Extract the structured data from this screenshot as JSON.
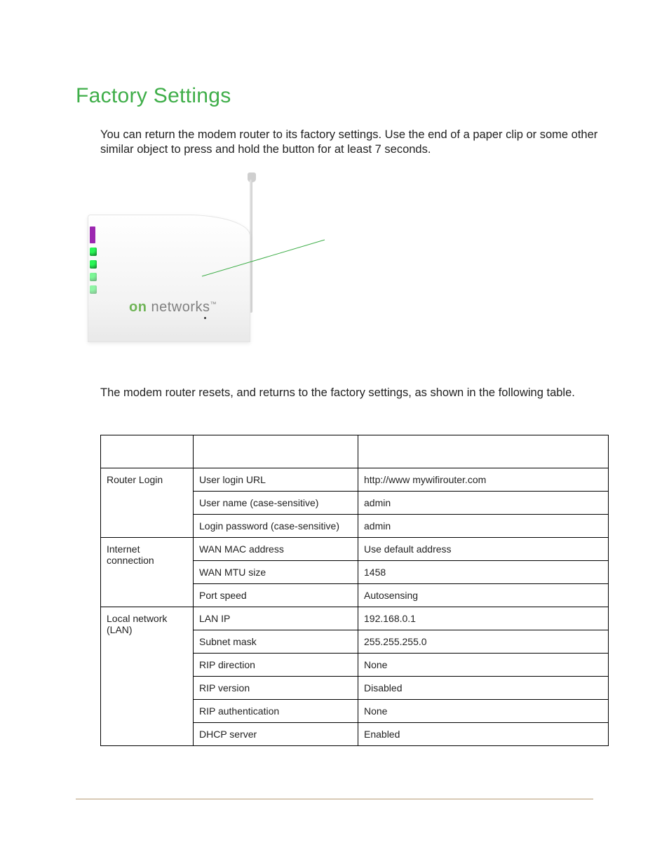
{
  "title": "Factory Settings",
  "intro": "You can return the modem router to its factory settings. Use the end of a paper clip or some other similar object to press and hold the            button for at least 7 seconds.",
  "image_brand_on": "on",
  "image_brand_rest": " networks",
  "image_brand_tm": "™",
  "leader_label": "",
  "post_image": "The modem router resets, and returns to the factory settings, as shown in the following table.",
  "table": {
    "headers": [
      "",
      "",
      ""
    ],
    "groups": [
      {
        "name": "Router Login",
        "rows": [
          {
            "feature": "User login URL",
            "default": "http://www mywifirouter.com"
          },
          {
            "feature": "User name (case-sensitive)",
            "default": "admin"
          },
          {
            "feature": "Login password (case-sensitive)",
            "default": "admin"
          }
        ]
      },
      {
        "name": "Internet connection",
        "rows": [
          {
            "feature": "WAN MAC address",
            "default": "Use default address"
          },
          {
            "feature": "WAN MTU size",
            "default": "1458"
          },
          {
            "feature": "Port speed",
            "default": "Autosensing"
          }
        ]
      },
      {
        "name": "Local network (LAN)",
        "rows": [
          {
            "feature": "LAN IP",
            "default": "192.168.0.1"
          },
          {
            "feature": "Subnet mask",
            "default": "255.255.255.0"
          },
          {
            "feature": "RIP direction",
            "default": "None"
          },
          {
            "feature": "RIP version",
            "default": "Disabled"
          },
          {
            "feature": "RIP authentication",
            "default": "None"
          },
          {
            "feature": "DHCP server",
            "default": "Enabled"
          }
        ]
      }
    ]
  }
}
